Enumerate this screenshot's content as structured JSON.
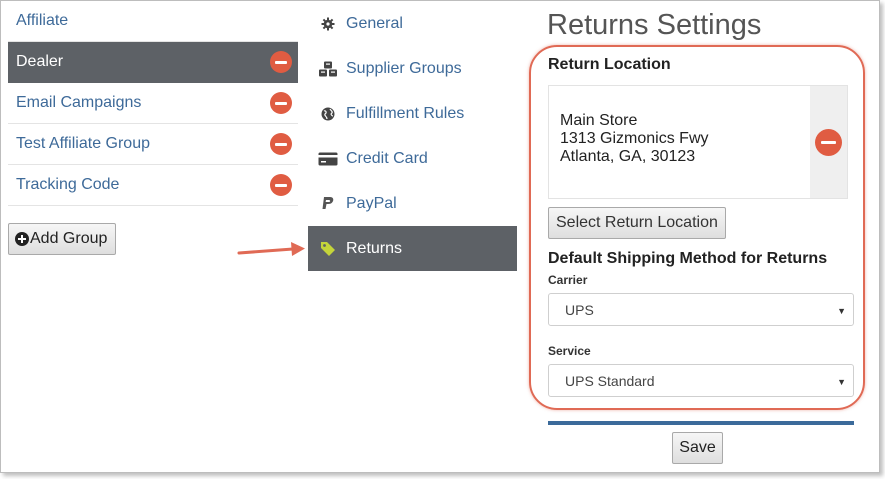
{
  "groups": {
    "items": [
      {
        "label": "Affiliate",
        "active": false,
        "removable": false
      },
      {
        "label": "Dealer",
        "active": true,
        "removable": true
      },
      {
        "label": "Email Campaigns",
        "active": false,
        "removable": true
      },
      {
        "label": "Test Affiliate Group",
        "active": false,
        "removable": true
      },
      {
        "label": "Tracking Code",
        "active": false,
        "removable": true
      }
    ],
    "add_label": "Add Group"
  },
  "nav": {
    "items": [
      {
        "label": "General",
        "icon": "gear-icon"
      },
      {
        "label": "Supplier Groups",
        "icon": "cubes-icon"
      },
      {
        "label": "Fulfillment Rules",
        "icon": "globe-icon"
      },
      {
        "label": "Credit Card",
        "icon": "credit-card-icon"
      },
      {
        "label": "PayPal",
        "icon": "paypal-icon"
      },
      {
        "label": "Returns",
        "icon": "tag-icon",
        "active": true
      }
    ]
  },
  "returns": {
    "title": "Returns Settings",
    "location_heading": "Return Location",
    "address": {
      "line1": "Main Store",
      "line2": "1313 Gizmonics Fwy",
      "line3": "Atlanta, GA, 30123"
    },
    "select_location_label": "Select Return Location",
    "shipping_heading": "Default Shipping Method for Returns",
    "carrier_label": "Carrier",
    "carrier_value": "UPS",
    "service_label": "Service",
    "service_value": "UPS Standard",
    "save_label": "Save"
  },
  "colors": {
    "active_bg": "#5d6166",
    "link": "#3e6a99",
    "remove": "#e05c42",
    "highlight": "#e06a55",
    "tag_icon": "#c4d43a",
    "divider": "#3b6a9a"
  }
}
